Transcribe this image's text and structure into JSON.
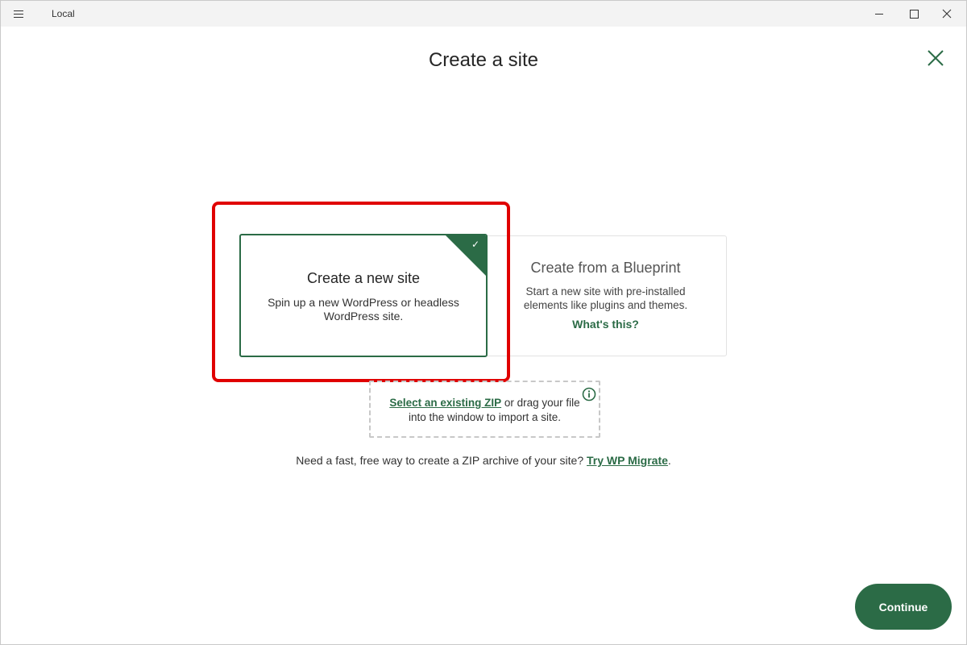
{
  "window": {
    "app_title": "Local"
  },
  "page": {
    "title": "Create a site"
  },
  "options": {
    "new_site": {
      "title": "Create a new site",
      "description": "Spin up a new WordPress or headless WordPress site.",
      "selected": true,
      "check_glyph": "✓"
    },
    "blueprint": {
      "title": "Create from a Blueprint",
      "description": "Start a new site with pre-installed elements like plugins and themes.",
      "link": "What's this?"
    }
  },
  "zip_import": {
    "link": "Select an existing ZIP",
    "text": " or drag your file into the window to import a site."
  },
  "migrate": {
    "text": "Need a fast, free way to create a ZIP archive of your site? ",
    "link": "Try WP Migrate",
    "suffix": "."
  },
  "actions": {
    "continue_label": "Continue"
  },
  "icons": {
    "menu": "hamburger-menu-icon",
    "minimize": "minimize-icon",
    "maximize": "maximize-icon",
    "close": "close-icon",
    "dismiss": "close-x-icon",
    "checkmark": "checkmark-icon",
    "info": "info-icon"
  },
  "colors": {
    "accent": "#2b6b46",
    "highlight": "#e00000",
    "titlebar": "#f3f3f3"
  }
}
